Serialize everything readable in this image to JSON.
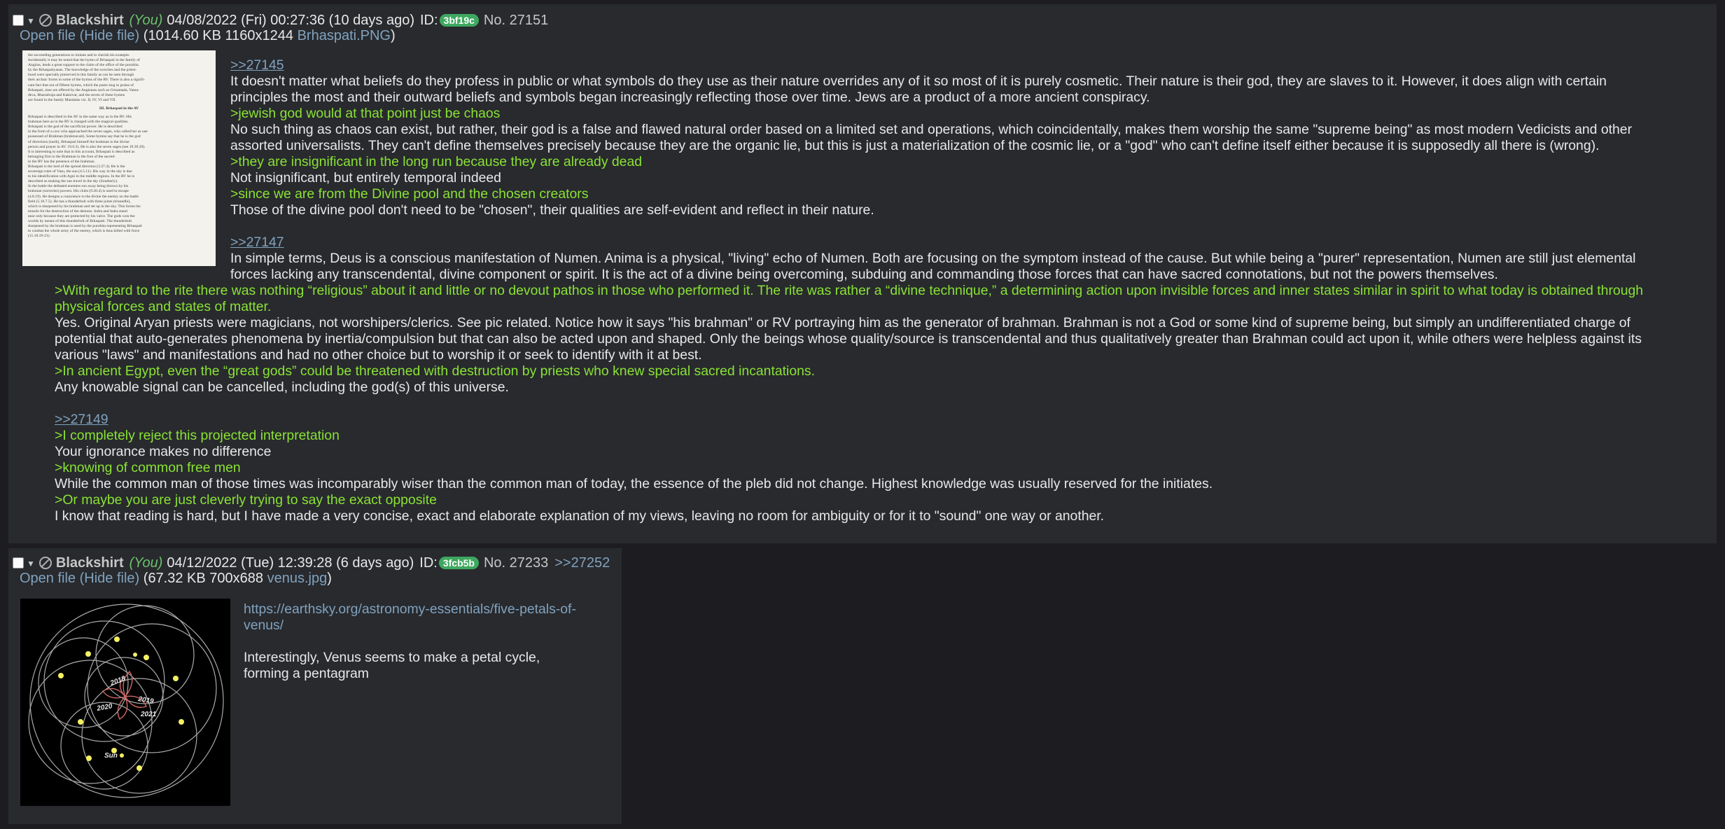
{
  "posts": [
    {
      "name": "Blackshirt",
      "you": "(You)",
      "date": "04/08/2022 (Fri) 00:27:36 (10 days ago)",
      "id_label": "ID:",
      "id": "3bf19c",
      "number": "No. 27151",
      "file": {
        "open": "Open file",
        "hide": "(Hide file)",
        "meta_open": "(",
        "meta": "1014.60 KB 1160x1244",
        "filename": "Brhaspati.PNG",
        "meta_close": ")"
      },
      "thumb_text": [
        "the succeeding generations to imitate and to cherish his example.",
        "Incidentally it may be noted that the hymn of Brhaspati in the family of",
        "Angiras, lends a great support to the claim of the office of the purohita",
        "by the Brhaspatiyanas. The knowledge of the scorches and the priest-",
        "hood were specially preserved in this family as can be seen through",
        "their archaic forms in some of the hymns of the RV. There is also a signifi-",
        "cant fact that out of fifteen hymns, which the poets sing in praise of",
        "Brhaspati, nine are offered by the Angirases such as Grtsamada, Vama-",
        "deva, Bharadvaja and Kaksivat, and the seven of these hymns",
        "are found in the family Mandalas viz. II, IV, VI and VII.",
        "III. Brhaspati in the AV",
        "Brhaspati is described in the AV in the same way as in the RV. His",
        "brahman here as in the RV is charged with the magical qualities.",
        "Brhaspati is the god of the sacrificial power. He is described",
        "in the form of a cow who approached the seven sages, who called her as one",
        "possessed of Brahman (brahmavati). Some hymns say that he is the god",
        "of directions (earth), Brhaspati himself the brahman is the divine",
        "person and prayer in AV. 19.6.3). He is also the seven sages (see 19.39.29).",
        "It is interesting to note that in this account, Brhaspati is described as",
        "belonging first to the Brahman to the fore of the sacred-",
        "in the RV has the presence of the brahman.",
        "Brhaspati is the lord of the spread direction (3.27.4). He is the",
        "sovereign ruler of Vasu, the sun (4.5.11). His way in the sky is due",
        "to his identification with Agni in the middle regions. In the RV he is",
        "described as making the sun travel in the sky (Southerly).",
        "In the battle the defeated enemies run away being thrown by his",
        "brahman (sorceries) powers. His clubs (9.20.4) is used to escape",
        "(4.8.19). He designs a conscience to the divine the enemy on the battle",
        "field (5.10.7.5). He has a thunderbolt with three joints (trisandhi),",
        "which is sharpened by his brahman and set up in the sky. This forms his",
        "missile for the destruction of the demons. Indra and Indra stand",
        "near only because they are protected by his valve. The gods won the",
        "worlds by means of this thunderbolt of Brhaspati. The thunderbolt",
        "sharpened by the brahman is used by the purohita representing Brhaspati",
        "to combat the whole army of the enemy, which is thus killed with force",
        "(11.10.19-21)."
      ],
      "body": {
        "q1": ">>27145",
        "p1": "It doesn't matter what beliefs do they profess in public or what symbols do they use as their nature overrides any of it so most of it is purely cosmetic. Their nature is their god, they are slaves to it. However, it does align with certain",
        "p1b": "principles the most and their outward beliefs and symbols began increasingly reflecting those over time. Jews are a product of a more ancient conspiracy.",
        "gt1": ">jewish god would at that point just be chaos",
        "p2": "No such thing as chaos can exist, but rather, their god is a false and flawed natural order based on a limited set and operations, which coincidentally, makes them worship the same \"supreme being\" as most modern Vedicists and other",
        "p2b": "assorted universalists. They can't define themselves precisely because they are the organic lie, but this is just a materialization of the cosmic lie, or a \"god\" who can't define itself either because it is supposedly all there is (wrong).",
        "gt2": ">they are insignificant in the long run because they are already dead",
        "p3": "Not insignificant, but entirely temporal indeed",
        "gt3": ">since we are from the Divine pool and the chosen creators",
        "p4": "Those of the divine pool don't need to be \"chosen\", their qualities are self-evident and reflect in their nature.",
        "q2": ">>27147",
        "p5": "In simple terms, Deus is a conscious manifestation of Numen. Anima is a physical, \"living\" echo of Numen. Both are focusing on the symptom instead of the cause. But while being a \"purer\" representation, Numen are still just elemental",
        "p5b": "forces lacking any transcendental, divine component or spirit. It is the act of a divine being overcoming, subduing and commanding those forces that can have sacred connotations, but not the powers themselves.",
        "gt4": ">With regard to the rite there was nothing “religious” about it and little or no devout pathos in those who performed it. The rite was rather a “divine technique,” a determining action upon invisible forces and inner states similar in spirit to what today is obtained through",
        "gt4b": "physical forces and states of matter.",
        "p6": "Yes. Original Aryan priests were magicians, not worshipers/clerics. See pic related. Notice how it says \"his brahman\" or RV portraying him as the generator of brahman. Brahman is not a God or some kind of supreme being, but simply an undifferentiated charge of",
        "p6b": "potential that auto-generates phenomena by inertia/compulsion but that can also be acted upon and shaped. Only the beings whose quality/source is transcendental and thus qualitatively greater than Brahman could act upon it, while others were helpless against its",
        "p6c": "various \"laws\" and manifestations and had no other choice but to worship it or seek to identify with it at best.",
        "gt5": ">In ancient Egypt, even the “great gods” could be threatened with destruction by priests who knew special sacred incantations.",
        "p7": "Any knowable signal can be cancelled, including the god(s) of this universe.",
        "q3": ">>27149",
        "gt6": ">I completely reject this projected interpretation",
        "p8": "Your ignorance makes no difference",
        "gt7": ">knowing of common free men",
        "p9": "While the common man of those times was incomparably wiser than the common man of today, the essence of the pleb did not change. Highest knowledge was usually reserved for the initiates.",
        "gt8": ">Or maybe you are just cleverly trying to say the exact opposite",
        "p10": "I know that reading is hard, but I have made a very concise, exact and elaborate explanation of my views, leaving no room for ambiguity or for it to \"sound\" one way or another."
      }
    },
    {
      "name": "Blackshirt",
      "you": "(You)",
      "date": "04/12/2022 (Tue) 12:39:28 (6 days ago)",
      "id_label": "ID:",
      "id": "3fcb5b",
      "number": "No. 27233",
      "reply": ">>27252",
      "file": {
        "open": "Open file",
        "hide": "(Hide file)",
        "meta_open": "(",
        "meta": "67.32 KB 700x688",
        "filename": "venus.jpg",
        "meta_close": ")"
      },
      "image_labels": {
        "sun": "Sun",
        "y2018": "2018",
        "y2019": "2019",
        "y2020": "2020",
        "y2021": "2021"
      },
      "body": {
        "url1": "https://earthsky.org/astronomy-essentials/five-petals-of-",
        "url2": "venus/",
        "p1": "Interestingly, Venus seems to make a petal cycle,",
        "p1b": "forming a pentagram"
      }
    }
  ]
}
